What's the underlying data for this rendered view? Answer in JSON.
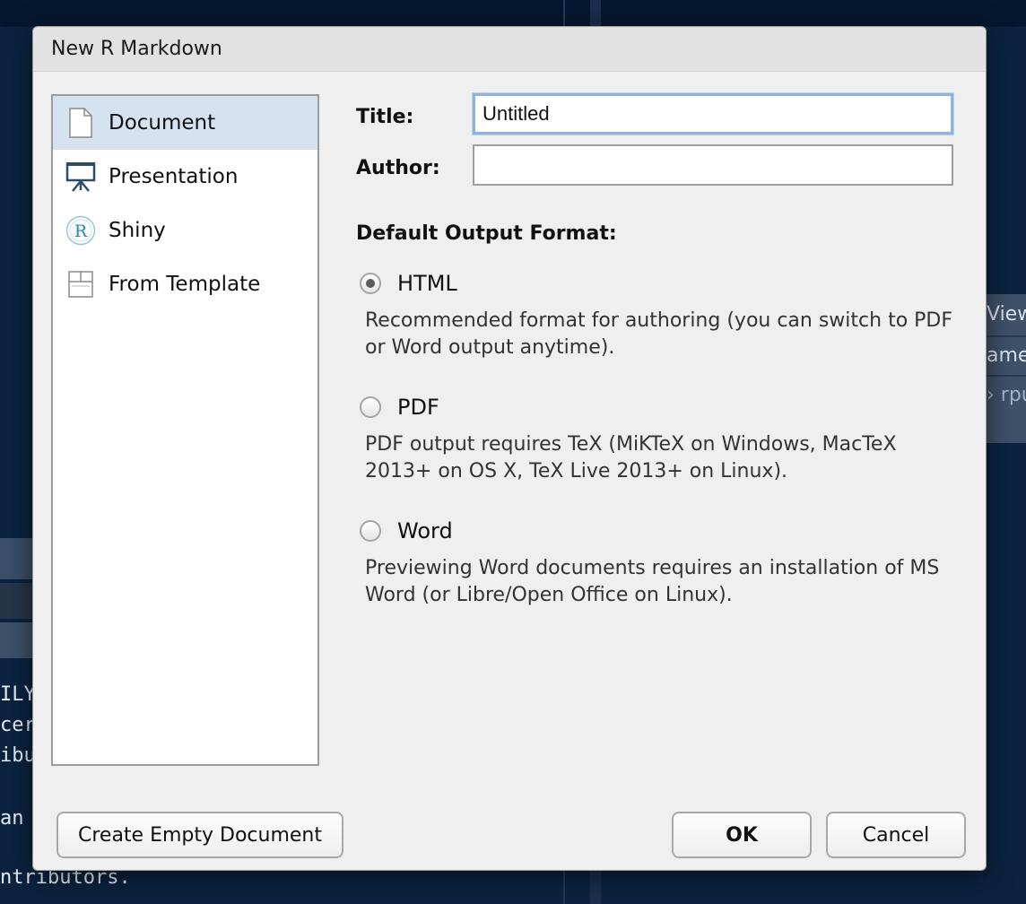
{
  "background": {
    "right_panel_lines": [
      "Viewe",
      "ame",
      "› rpu"
    ],
    "code_lines": [
      "ILY",
      "cert",
      "ibut",
      "an"
    ],
    "code_bottom": "ntributors."
  },
  "dialog": {
    "title": "New R Markdown",
    "types": [
      {
        "label": "Document",
        "icon": "document-icon"
      },
      {
        "label": "Presentation",
        "icon": "presentation-easel-icon"
      },
      {
        "label": "Shiny",
        "icon": "shiny-r-logo-icon"
      },
      {
        "label": "From Template",
        "icon": "template-icon"
      }
    ],
    "selected_type": "Document",
    "form": {
      "title_label": "Title:",
      "title_value": "Untitled",
      "author_label": "Author:",
      "author_value": ""
    },
    "output_format": {
      "heading": "Default Output Format:",
      "selected": "HTML",
      "options": [
        {
          "label": "HTML",
          "description": "Recommended format for authoring (you can switch to PDF or Word output anytime)."
        },
        {
          "label": "PDF",
          "description": "PDF output requires TeX (MiKTeX on Windows, MacTeX 2013+ on OS X, TeX Live 2013+ on Linux)."
        },
        {
          "label": "Word",
          "description": "Previewing Word documents requires an installation of MS Word (or Libre/Open Office on Linux)."
        }
      ]
    },
    "buttons": {
      "create_empty": "Create Empty Document",
      "ok": "OK",
      "cancel": "Cancel"
    },
    "colors": {
      "selected_row": "#d5e3f0",
      "focus_border": "#8fb3db",
      "ide_background": "#0b2340"
    }
  }
}
